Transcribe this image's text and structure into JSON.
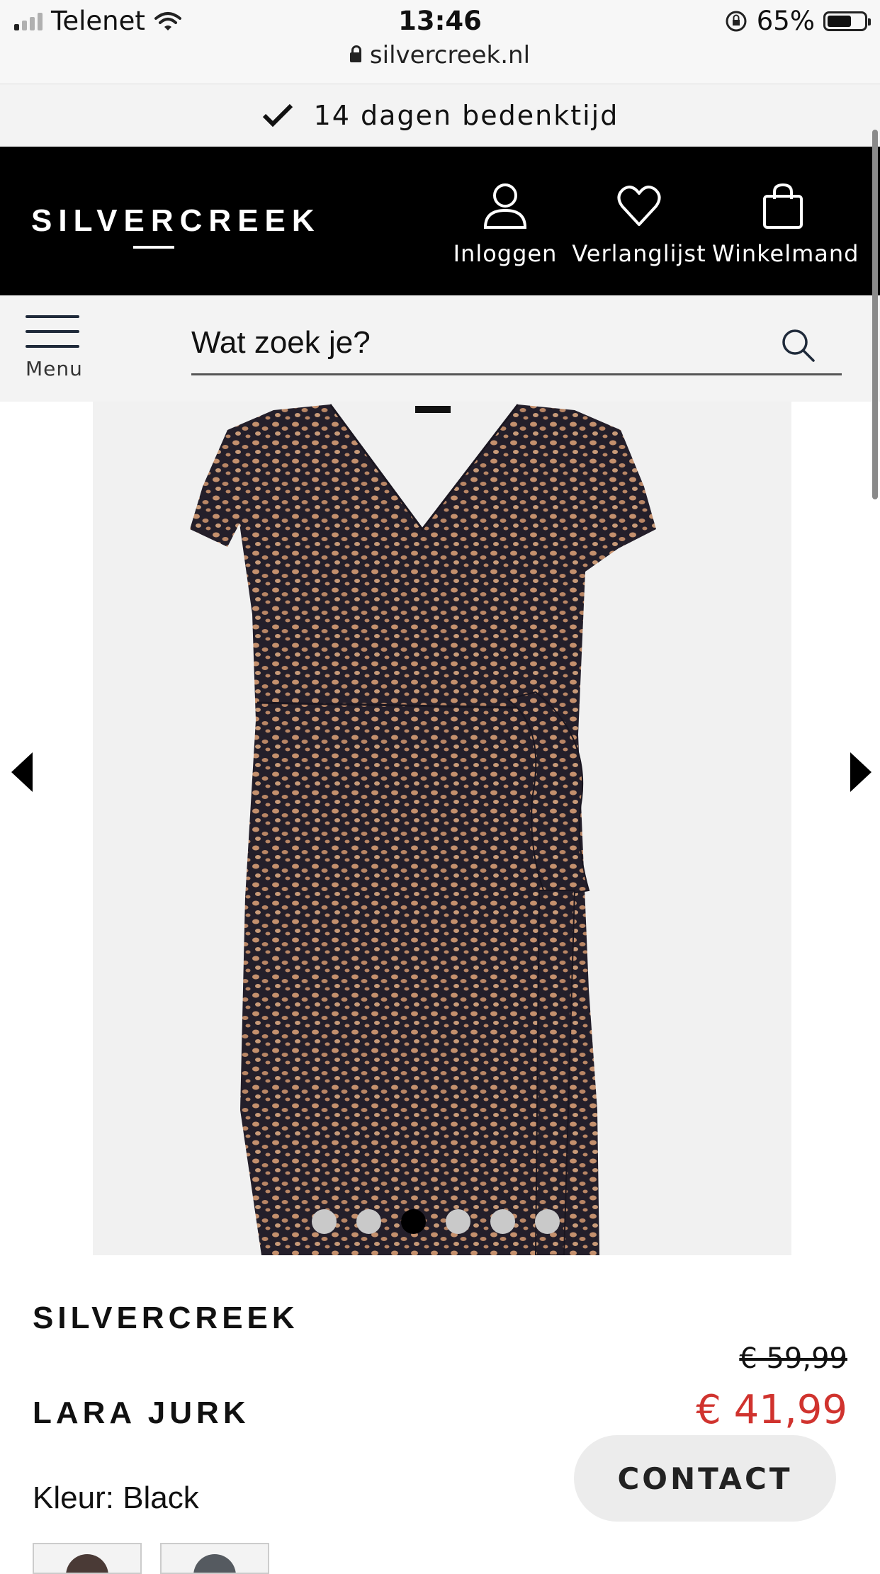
{
  "status_bar": {
    "carrier": "Telenet",
    "time": "13:46",
    "battery": "65%",
    "battery_level": 0.65,
    "url": "silvercreek.nl"
  },
  "promo": {
    "text": "14 dagen bedenktijd"
  },
  "header": {
    "logo": "SILVERCREEK",
    "login_label": "Inloggen",
    "wishlist_label": "Verlanglijst",
    "cart_label": "Winkelmand"
  },
  "search": {
    "menu_label": "Menu",
    "placeholder": "Wat zoek je?"
  },
  "gallery": {
    "dot_count": 6,
    "active_dot": 3
  },
  "product": {
    "brand": "SILVERCREEK",
    "name": "LARA JURK",
    "old_price": "€ 59,99",
    "price": "€ 41,99",
    "color_label": "Kleur:",
    "color_value": "Black"
  },
  "contact_label": "CONTACT",
  "colors": {
    "price_red": "#d0332e",
    "header_bg": "#000000",
    "dress_base": "#241f2a",
    "dress_print": "#c4906d"
  }
}
